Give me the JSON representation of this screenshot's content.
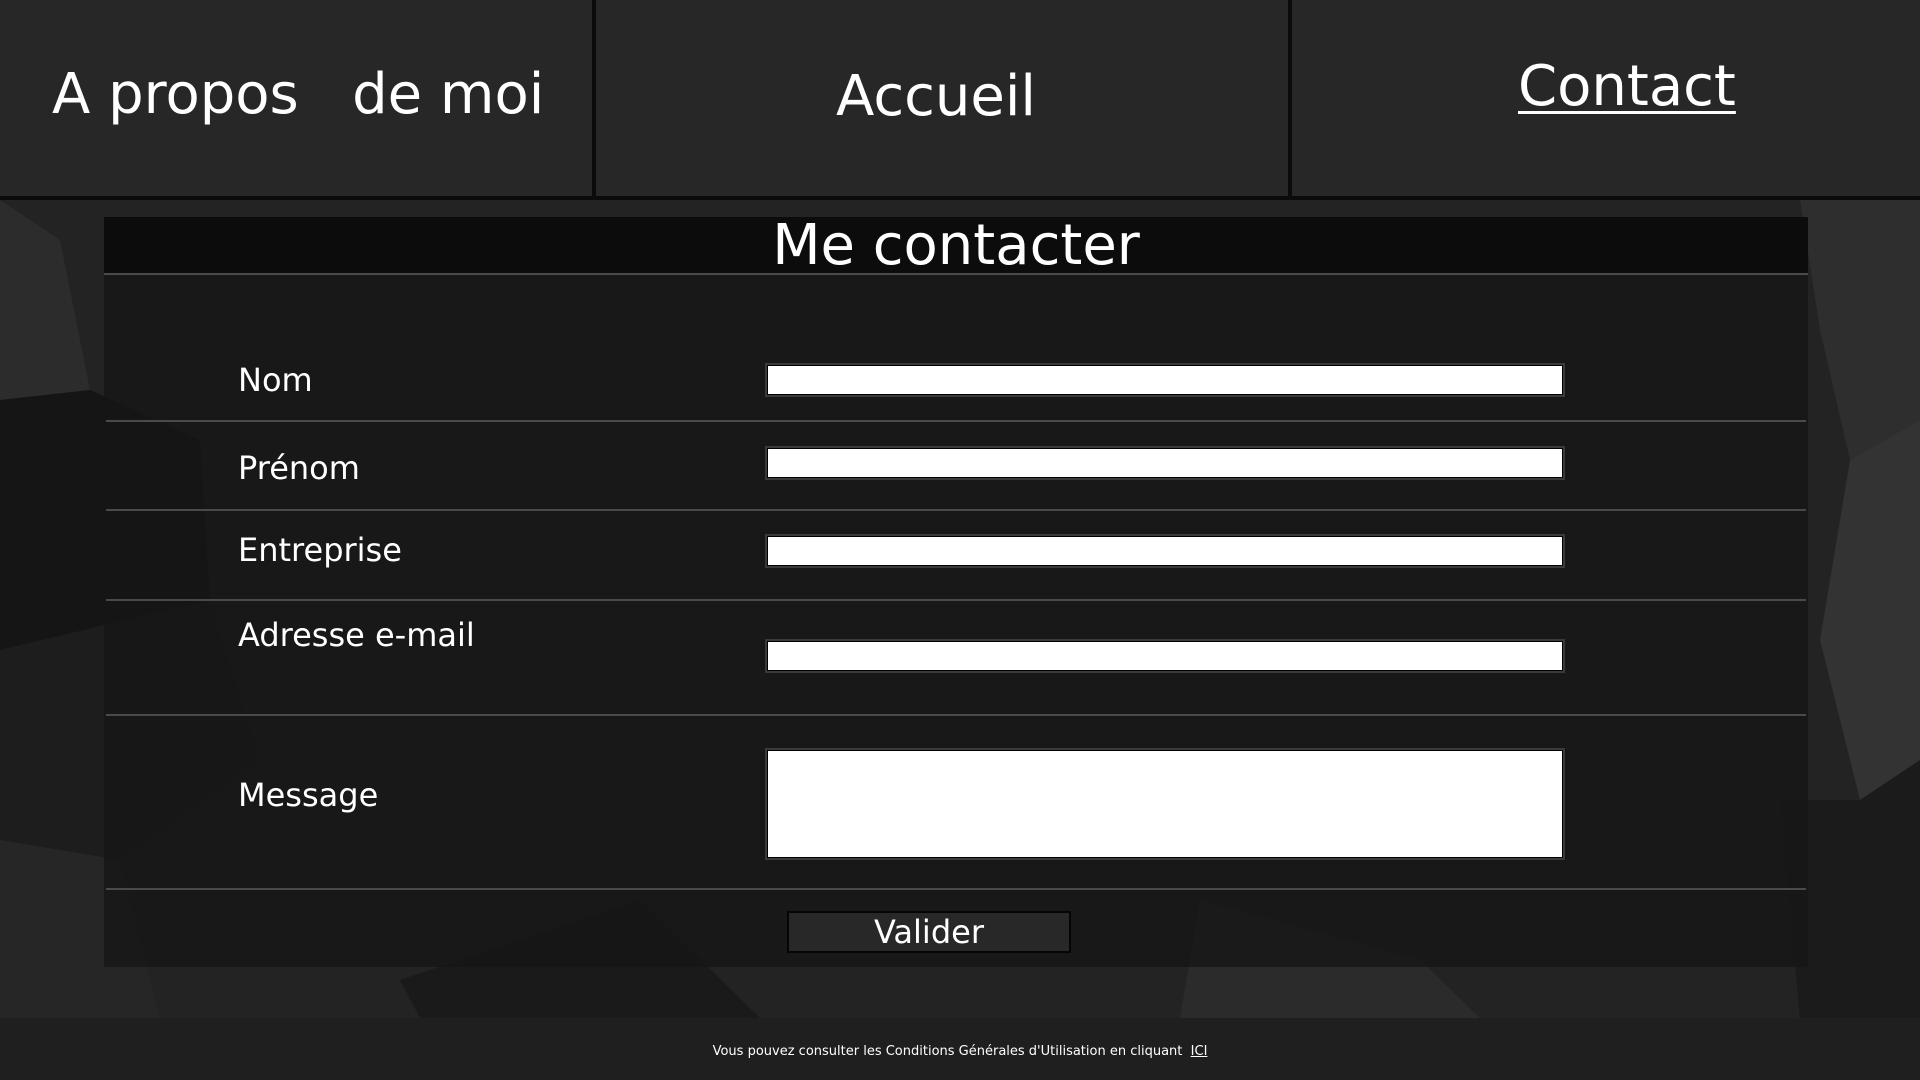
{
  "nav": {
    "items": [
      {
        "label": "A propos   de moi"
      },
      {
        "label": "Accueil"
      },
      {
        "label": "Contact",
        "active": true
      }
    ]
  },
  "form": {
    "title": "Me contacter",
    "fields": [
      {
        "label": "Nom",
        "value": "",
        "type": "text"
      },
      {
        "label": "Prénom",
        "value": "",
        "type": "text"
      },
      {
        "label": "Entreprise",
        "value": "",
        "type": "text"
      },
      {
        "label": "Adresse e-mail",
        "value": "",
        "type": "email"
      },
      {
        "label": "Message",
        "value": "",
        "type": "textarea"
      }
    ],
    "submit_label": "Valider"
  },
  "footer": {
    "text": "Vous pouvez consulter les Conditions Générales d'Utilisation en cliquant  ",
    "link_label": "ICI"
  },
  "colors": {
    "background": "#242424",
    "nav_cell": "#272727",
    "panel": "#161616",
    "title_bar": "#0c0c0c",
    "input": "#ffffff",
    "text": "#ffffff"
  }
}
